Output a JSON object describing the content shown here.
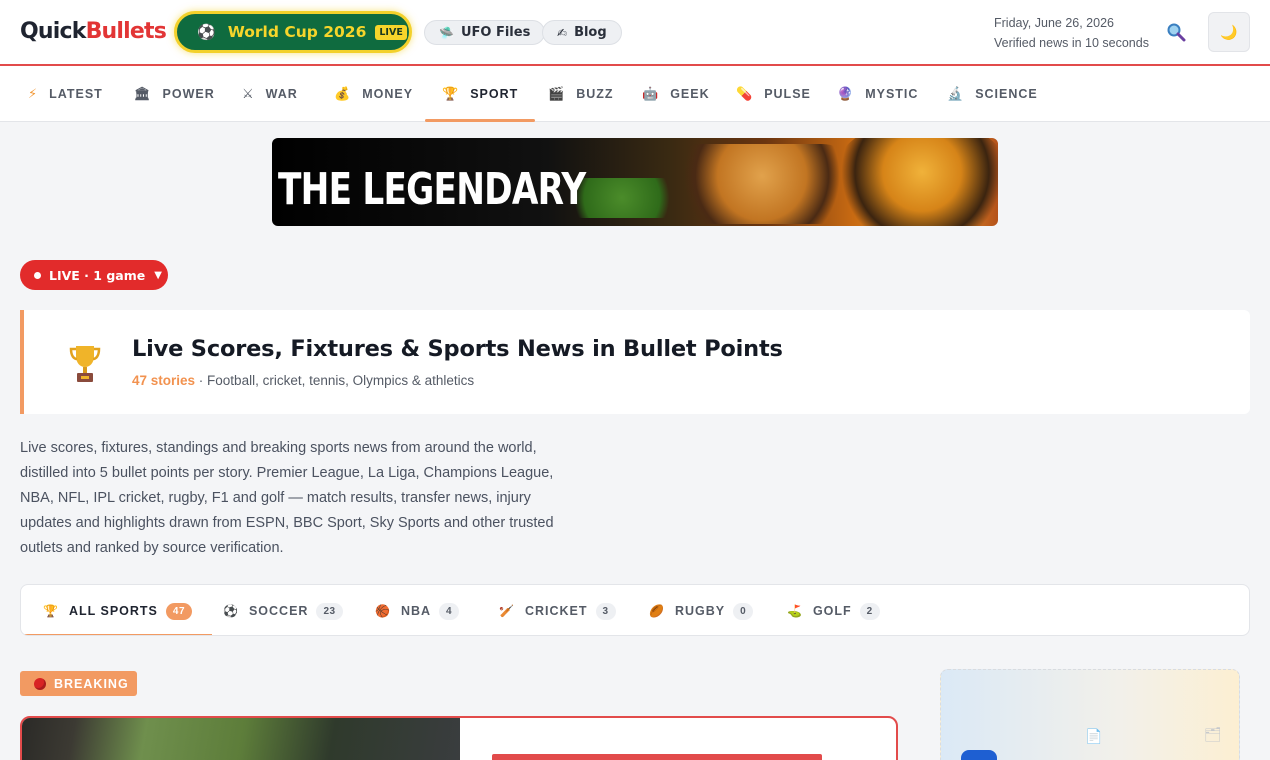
{
  "header": {
    "logo_part1": "Quick",
    "logo_part2": "Bullets",
    "world_cup": {
      "label": "World Cup 2026",
      "badge": "LIVE",
      "icon": "soccer-ball-icon"
    },
    "pills": [
      {
        "label": "UFO Files",
        "icon": "ufo-icon"
      },
      {
        "label": "Blog",
        "icon": "writing-hand-icon"
      }
    ],
    "date": "Friday, June 26, 2026",
    "tagline": "Verified news in 10 seconds",
    "theme_icon": "moon-icon",
    "search_icon": "search-icon"
  },
  "nav": {
    "items": [
      {
        "label": "LATEST",
        "icon": "lightning-icon"
      },
      {
        "label": "POWER",
        "icon": "classical-building-icon"
      },
      {
        "label": "WAR",
        "icon": "crossed-swords-icon"
      },
      {
        "label": "MONEY",
        "icon": "money-bag-icon"
      },
      {
        "label": "SPORT",
        "icon": "trophy-icon"
      },
      {
        "label": "BUZZ",
        "icon": "clapper-board-icon"
      },
      {
        "label": "GEEK",
        "icon": "robot-icon"
      },
      {
        "label": "PULSE",
        "icon": "pill-icon"
      },
      {
        "label": "MYSTIC",
        "icon": "crystal-ball-icon"
      },
      {
        "label": "SCIENCE",
        "icon": "microscope-icon"
      }
    ],
    "active": "SPORT"
  },
  "banner": {
    "text": "THE LEGENDARY"
  },
  "live_toggle": {
    "label": "LIVE · 1 game",
    "caret": "▼"
  },
  "page": {
    "title": "Live Scores, Fixtures & Sports News in Bullet Points",
    "story_count": "47 stories",
    "subtitle": " · Football, cricket, tennis, Olympics & athletics",
    "description": "Live scores, fixtures, standings and breaking sports news from around the world, distilled into 5 bullet points per story. Premier League, La Liga, Champions League, NBA, NFL, IPL cricket, rugby, F1 and golf — match results, transfer news, injury updates and highlights drawn from ESPN, BBC Sport, Sky Sports and other trusted outlets and ranked by source verification."
  },
  "sport_tabs": [
    {
      "label": "ALL SPORTS",
      "count": "47",
      "icon": "trophy-icon"
    },
    {
      "label": "SOCCER",
      "count": "23",
      "icon": "soccer-ball-icon"
    },
    {
      "label": "NBA",
      "count": "4",
      "icon": "basketball-icon"
    },
    {
      "label": "CRICKET",
      "count": "3",
      "icon": "cricket-bat-icon"
    },
    {
      "label": "RUGBY",
      "count": "0",
      "icon": "rugby-ball-icon"
    },
    {
      "label": "GOLF",
      "count": "2",
      "icon": "golf-flag-icon"
    }
  ],
  "breaking": {
    "label": "BREAKING"
  },
  "colors": {
    "accent": "#f29a62",
    "brand_red": "#e23535",
    "live_red": "#e22b2b",
    "world_cup_green": "#0f6b3f",
    "world_cup_yellow": "#f6d52b"
  }
}
